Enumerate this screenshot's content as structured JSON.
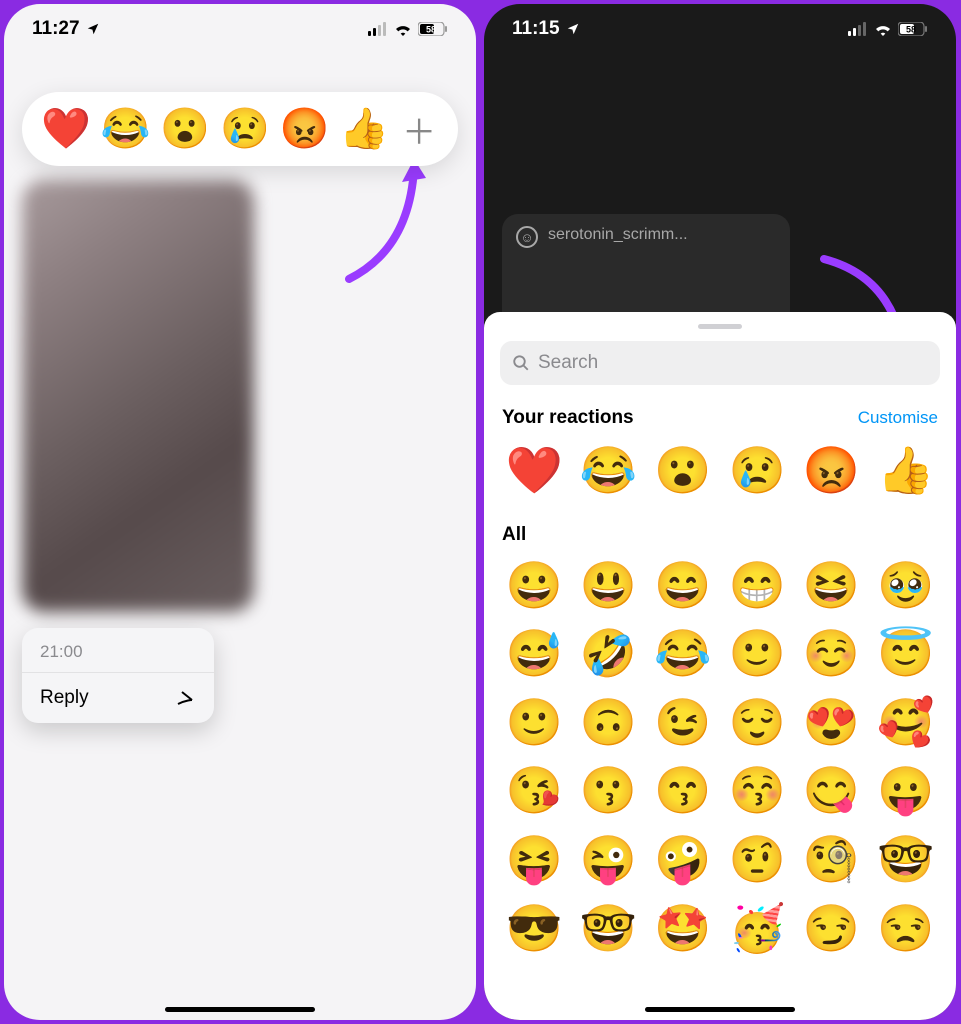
{
  "left": {
    "time": "11:27",
    "battery": "58",
    "reactions": [
      "❤️",
      "😂",
      "😮",
      "😢",
      "😡",
      "👍"
    ],
    "plus": "＋",
    "context": {
      "time": "21:00",
      "reply": "Reply"
    }
  },
  "right": {
    "time": "11:15",
    "battery": "58",
    "user_tag": "serotonin_scrimm...",
    "search_placeholder": "Search",
    "section_reactions": "Your reactions",
    "customise": "Customise",
    "reactions": [
      "❤️",
      "😂",
      "😮",
      "😢",
      "😡",
      "👍"
    ],
    "section_all": "All",
    "all_emoji": [
      "😀",
      "😃",
      "😄",
      "😁",
      "😆",
      "🥹",
      "😅",
      "🤣",
      "😂",
      "🙂",
      "☺️",
      "😇",
      "🙂",
      "🙃",
      "😉",
      "😌",
      "😍",
      "🥰",
      "😘",
      "😗",
      "😙",
      "😚",
      "😋",
      "😛",
      "😝",
      "😜",
      "🤪",
      "🤨",
      "🧐",
      "🤓",
      "😎",
      "🤓",
      "🤩",
      "🥳",
      "😏",
      "😒"
    ]
  }
}
